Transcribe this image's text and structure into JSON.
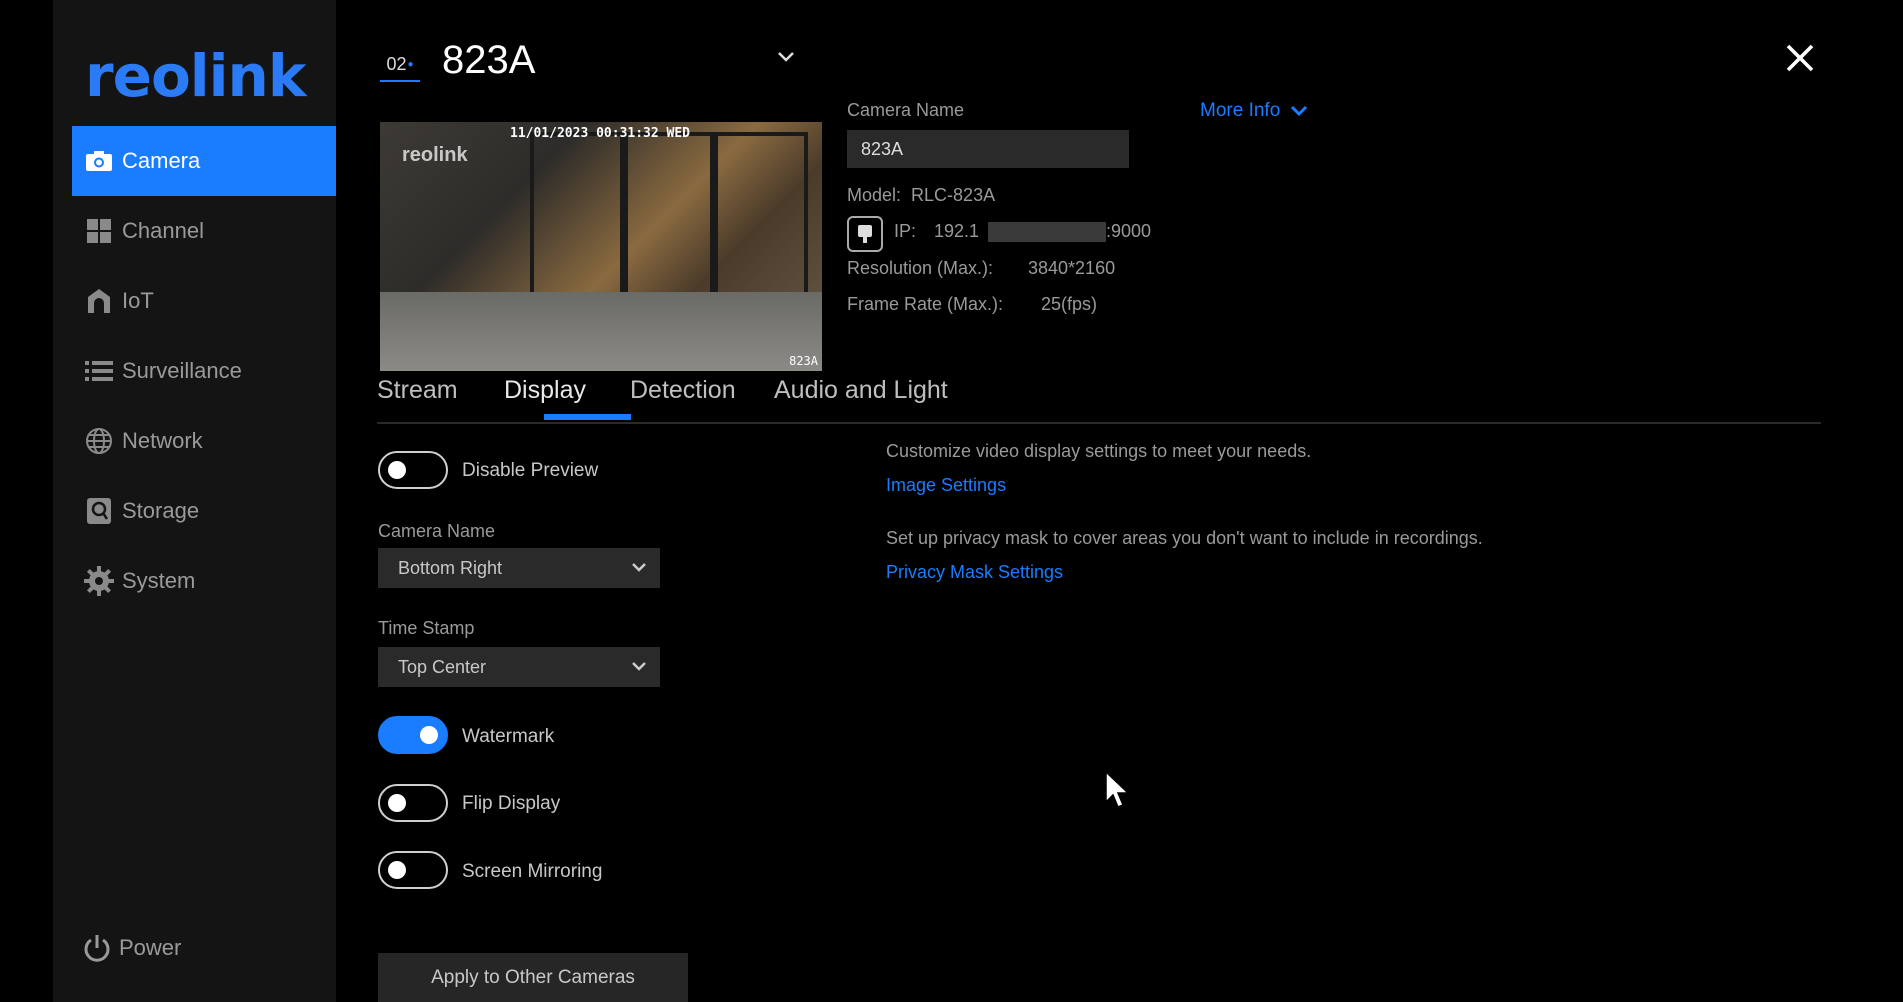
{
  "sidebar": {
    "logo": "reolink",
    "items": [
      {
        "label": "Camera",
        "icon": "camera-icon",
        "active": true
      },
      {
        "label": "Channel",
        "icon": "grid-icon",
        "active": false
      },
      {
        "label": "IoT",
        "icon": "home-icon",
        "active": false
      },
      {
        "label": "Surveillance",
        "icon": "list-icon",
        "active": false
      },
      {
        "label": "Network",
        "icon": "globe-icon",
        "active": false
      },
      {
        "label": "Storage",
        "icon": "storage-icon",
        "active": false
      },
      {
        "label": "System",
        "icon": "gear-icon",
        "active": false
      }
    ],
    "power_label": "Power"
  },
  "header": {
    "channel_number": "02",
    "camera_title": "823A"
  },
  "preview": {
    "timestamp": "11/01/2023 00:31:32 WED",
    "watermark": "reolink",
    "camera_label": "823A"
  },
  "info": {
    "camera_name_label": "Camera Name",
    "camera_name_value": "823A",
    "more_info_label": "More Info",
    "model_label": "Model:",
    "model_value": "RLC-823A",
    "ip_label": "IP:",
    "ip_prefix": "192.1",
    "ip_suffix": ":9000",
    "resolution_label": "Resolution (Max.):",
    "resolution_value": "3840*2160",
    "framerate_label": "Frame Rate (Max.):",
    "framerate_value": "25(fps)"
  },
  "tabs": [
    {
      "label": "Stream",
      "active": false
    },
    {
      "label": "Display",
      "active": true
    },
    {
      "label": "Detection",
      "active": false
    },
    {
      "label": "Audio and Light",
      "active": false
    }
  ],
  "display": {
    "disable_preview_label": "Disable Preview",
    "disable_preview_on": false,
    "camera_name_field_label": "Camera Name",
    "camera_name_position": "Bottom Right",
    "time_stamp_label": "Time Stamp",
    "time_stamp_position": "Top Center",
    "watermark_label": "Watermark",
    "watermark_on": true,
    "flip_display_label": "Flip Display",
    "flip_display_on": false,
    "screen_mirroring_label": "Screen Mirroring",
    "screen_mirroring_on": false,
    "apply_button_label": "Apply to Other Cameras",
    "image_desc": "Customize video display settings to meet your needs.",
    "image_settings_link": "Image Settings",
    "privacy_desc": "Set up privacy mask to cover areas you don't want to include in recordings.",
    "privacy_mask_link": "Privacy Mask Settings"
  },
  "colors": {
    "accent": "#1a7cff",
    "background": "#000000",
    "sidebar": "#141414"
  }
}
